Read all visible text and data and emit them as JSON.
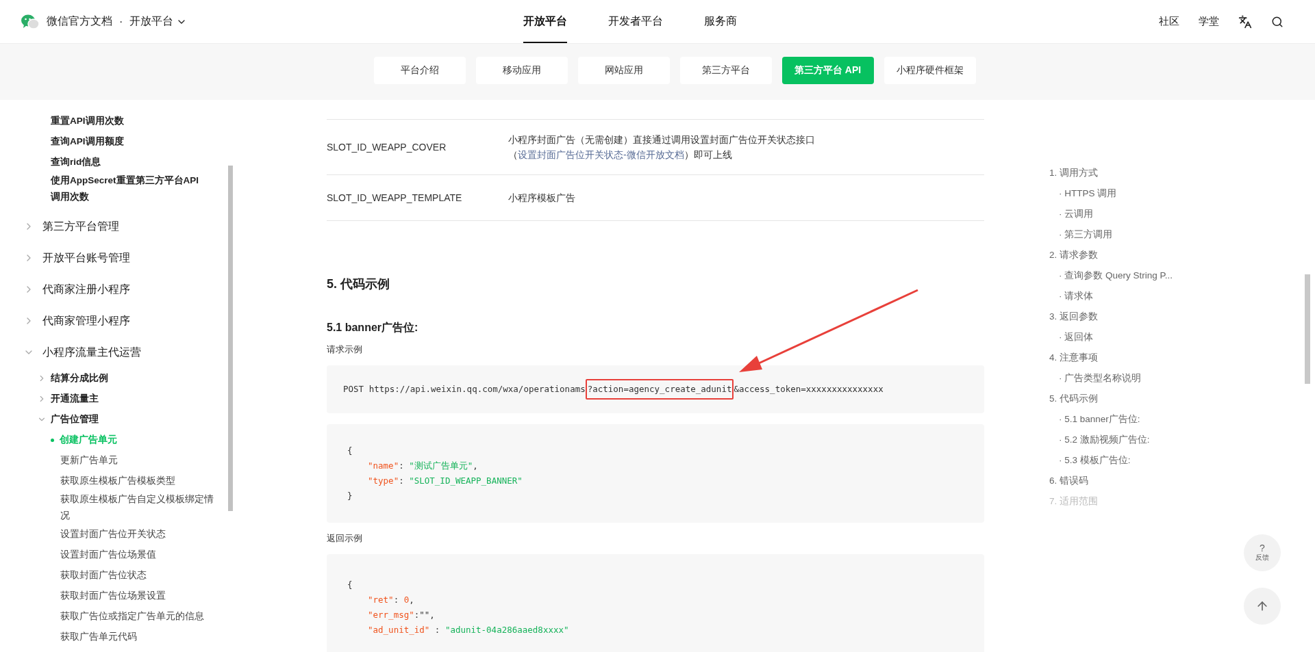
{
  "header": {
    "brand": "微信官方文档",
    "separator": "·",
    "platform": "开放平台",
    "nav": [
      {
        "label": "开放平台",
        "selected": true
      },
      {
        "label": "开发者平台",
        "selected": false
      },
      {
        "label": "服务商",
        "selected": false
      }
    ],
    "links": [
      "社区",
      "学堂"
    ]
  },
  "subnav": [
    {
      "label": "平台介绍",
      "selected": false
    },
    {
      "label": "移动应用",
      "selected": false
    },
    {
      "label": "网站应用",
      "selected": false
    },
    {
      "label": "第三方平台",
      "selected": false
    },
    {
      "label": "第三方平台 API",
      "selected": true
    },
    {
      "label": "小程序硬件框架",
      "selected": false
    }
  ],
  "sidebar": {
    "partial_group": [
      "重置API调用次数",
      "查询API调用额度",
      "查询rid信息",
      "使用AppSecret重置第三方平台API调用次数"
    ],
    "items": [
      {
        "label": "第三方平台管理",
        "expanded": false
      },
      {
        "label": "开放平台账号管理",
        "expanded": false
      },
      {
        "label": "代商家注册小程序",
        "expanded": false
      },
      {
        "label": "代商家管理小程序",
        "expanded": false
      },
      {
        "label": "小程序流量主代运营",
        "expanded": true,
        "children": [
          {
            "label": "结算分成比例",
            "expanded": false
          },
          {
            "label": "开通流量主",
            "expanded": false
          },
          {
            "label": "广告位管理",
            "expanded": true,
            "children": [
              {
                "label": "创建广告单元",
                "selected": true
              },
              {
                "label": "更新广告单元",
                "selected": false
              },
              {
                "label": "获取原生模板广告模板类型",
                "selected": false
              },
              {
                "label": "获取原生模板广告自定义模板绑定情况",
                "selected": false
              },
              {
                "label": "设置封面广告位开关状态",
                "selected": false
              },
              {
                "label": "设置封面广告位场景值",
                "selected": false
              },
              {
                "label": "获取封面广告位状态",
                "selected": false
              },
              {
                "label": "获取封面广告位场景设置",
                "selected": false
              },
              {
                "label": "获取广告位或指定广告单元的信息",
                "selected": false
              },
              {
                "label": "获取广告单元代码",
                "selected": false
              }
            ]
          }
        ]
      }
    ]
  },
  "ad_table": {
    "rows": [
      {
        "name": "SLOT_ID_WEAPP_COVER",
        "description": "小程序封面广告（无需创建）直接通过调用设置封面广告位开关状态接口（",
        "link": "设置封面广告位开关状态-微信开放文档",
        "after": "）即可上线"
      },
      {
        "name": "SLOT_ID_WEAPP_TEMPLATE",
        "description": "小程序模板广告"
      }
    ]
  },
  "section_heading": "5. 代码示例",
  "subsection_heading": "5.1 banner广告位:",
  "request_label": "请求示例",
  "request_code": [
    [
      {
        "kind": "plain",
        "text": "POST https://api.weixin.qq.com/wxa/operationams"
      },
      {
        "kind": "highlight",
        "text": "?action=agency_create_adunit"
      },
      {
        "kind": "plain",
        "text": "&access_token=xxxxxxxxxxxxxxx"
      }
    ]
  ],
  "request_body": {
    "open": "{",
    "entries": [
      [
        {
          "kind": "key",
          "text": "\"name\""
        },
        {
          "kind": "plain",
          "text": ": "
        },
        {
          "kind": "string",
          "text": "\"测试广告单元\""
        },
        {
          "kind": "plain",
          "text": ","
        }
      ],
      [
        {
          "kind": "key",
          "text": "\"type\""
        },
        {
          "kind": "plain",
          "text": ": "
        },
        {
          "kind": "string",
          "text": "\"SLOT_ID_WEAPP_BANNER\""
        }
      ]
    ],
    "close": "}"
  },
  "response_label": "返回示例",
  "response_body": {
    "open": "{",
    "entries": [
      [
        {
          "kind": "key",
          "text": "\"ret\""
        },
        {
          "kind": "plain",
          "text": ": "
        },
        {
          "kind": "number",
          "text": "0"
        },
        {
          "kind": "plain",
          "text": ","
        }
      ],
      [
        {
          "kind": "key",
          "text": "\"err_msg\""
        },
        {
          "kind": "plain",
          "text": ":\"\","
        }
      ],
      [
        {
          "kind": "key",
          "text": "\"ad_unit_id\""
        },
        {
          "kind": "plain",
          "text": " : "
        },
        {
          "kind": "string",
          "text": "\"adunit-04a286aaed8xxxx\""
        }
      ]
    ]
  },
  "toc": [
    {
      "label": "1. 调用方式",
      "kind": "section",
      "disabled": false
    },
    {
      "label": "· HTTPS 调用",
      "kind": "sub",
      "disabled": false
    },
    {
      "label": "· 云调用",
      "kind": "sub",
      "disabled": false
    },
    {
      "label": "· 第三方调用",
      "kind": "sub",
      "disabled": false
    },
    {
      "label": "2. 请求参数",
      "kind": "section",
      "disabled": false
    },
    {
      "label": "· 查询参数 Query String P...",
      "kind": "sub",
      "disabled": false
    },
    {
      "label": "· 请求体",
      "kind": "sub",
      "disabled": false
    },
    {
      "label": "3. 返回参数",
      "kind": "section",
      "disabled": false
    },
    {
      "label": "· 返回体",
      "kind": "sub",
      "disabled": false
    },
    {
      "label": "4. 注意事项",
      "kind": "section",
      "disabled": false
    },
    {
      "label": "· 广告类型名称说明",
      "kind": "sub",
      "disabled": false
    },
    {
      "label": "5. 代码示例",
      "kind": "section",
      "disabled": false
    },
    {
      "label": "· 5.1 banner广告位:",
      "kind": "sub",
      "disabled": false
    },
    {
      "label": "· 5.2 激励视频广告位:",
      "kind": "sub",
      "disabled": false
    },
    {
      "label": "· 5.3 模板广告位:",
      "kind": "sub",
      "disabled": false
    },
    {
      "label": "6. 错误码",
      "kind": "section",
      "disabled": false
    },
    {
      "label": "7. 适用范围",
      "kind": "section",
      "disabled": true
    }
  ],
  "feedback": {
    "mark": "?",
    "label": "反馈"
  }
}
